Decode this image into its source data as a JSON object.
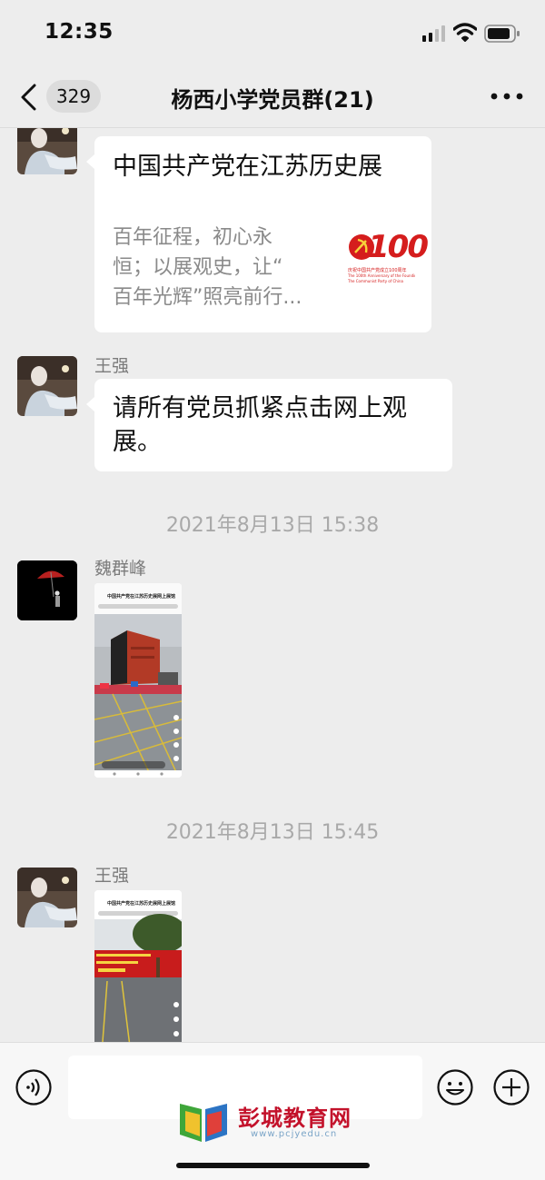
{
  "status_bar": {
    "time": "12:35"
  },
  "nav": {
    "back_count": "329",
    "title": "杨西小学党员群(21)"
  },
  "messages": {
    "link_card": {
      "title": "中国共产党在江苏历史展",
      "desc_line1": "百年征程，初心永",
      "desc_line2": "恒；以展观史，让“",
      "desc_line3": "百年光辉”照亮前行...",
      "thumb_number": "100",
      "thumb_caption1": "庆祝中国共产党成立100周年",
      "thumb_caption2": "The 100th Anniversary of the Founding of",
      "thumb_caption3": "The Communist Party of China"
    },
    "msg2": {
      "sender": "王强",
      "text_line1": "请所有党员抓紧点击网上观",
      "text_line2": "展。"
    },
    "time1": "2021年8月13日 15:38",
    "msg3": {
      "sender": "魏群峰",
      "shot_title": "中国共产党在江苏历史展网上展馆"
    },
    "time2": "2021年8月13日 15:45",
    "msg4": {
      "sender": "王强",
      "shot_title": "中国共产党在江苏历史展网上展馆"
    }
  },
  "input": {
    "placeholder": ""
  },
  "watermark": {
    "text": "彭城教育网",
    "url": "www.pcjyedu.cn"
  },
  "colors": {
    "party_red": "#d51d1d",
    "bubble": "#ffffff",
    "background": "#ededed"
  }
}
